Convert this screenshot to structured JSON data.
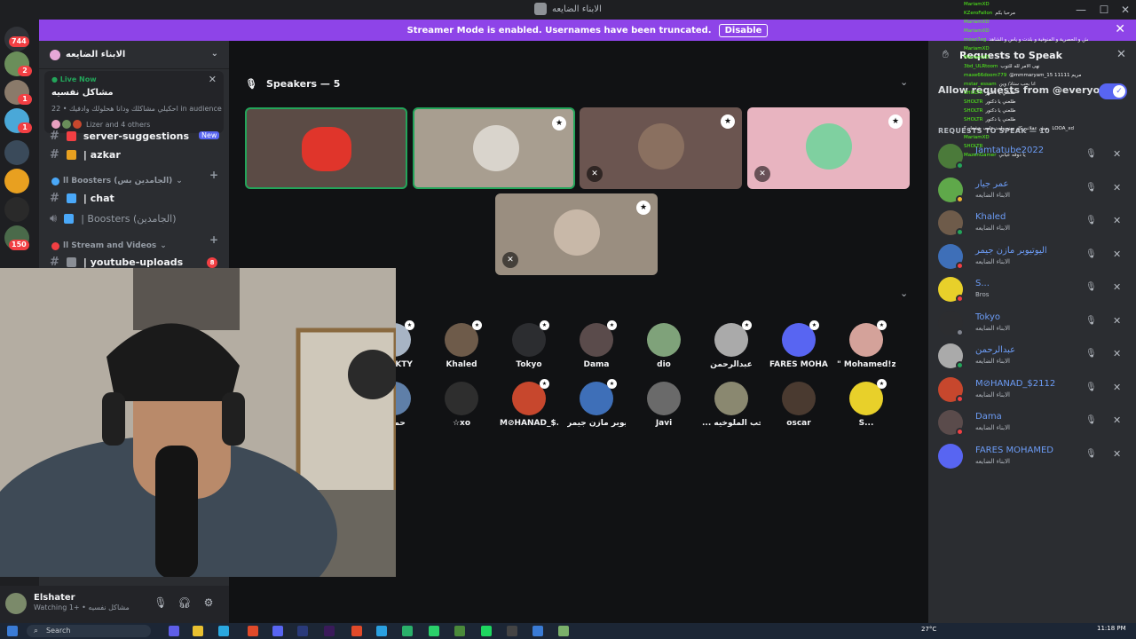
{
  "window": {
    "title": "الابناء الضايعه"
  },
  "banner": {
    "message": "Streamer Mode is enabled. Usernames have been truncated.",
    "disable_label": "Disable"
  },
  "rail": {
    "badges": [
      "744",
      "2",
      "1",
      "1",
      "150"
    ]
  },
  "sidebar": {
    "server_name": "الابناء الضايعه",
    "live": {
      "label": "Live Now",
      "title": "مشاكل نفسيه",
      "description": "احكيلي مشاكلك ودانا هحلولك وادفيك • 22 in audience",
      "others": "Lizer and 4 others"
    },
    "channels": {
      "server_suggestions": "server-suggestions",
      "server_suggestions_badge": "New",
      "azkar": "| azkar",
      "boosters_category": "ll Boosters (الجامدين بس)",
      "chat": "| chat",
      "boosters_voice": "| Boosters (الجامدين)",
      "stream_category": "ll Stream and Videos",
      "youtube": "| youtube-uploads",
      "youtube_badge": "8"
    }
  },
  "user": {
    "name": "Elshater",
    "status": "Watching مشاكل نفسيه • +1"
  },
  "stage": {
    "speakers_header": "Speakers — 5"
  },
  "audience": [
    {
      "name": "AOOKTY",
      "color": "#a7b4c4"
    },
    {
      "name": "Khaled",
      "color": "#6e5b4a"
    },
    {
      "name": "Tokyo",
      "color": "#2c2d30"
    },
    {
      "name": "Dama",
      "color": "#5a4b4b"
    },
    {
      "name": "dio",
      "color": "#7fa27a"
    },
    {
      "name": "عبدالرحمن",
      "color": "#aaaaaa"
    },
    {
      "name": "FARES MOHA...",
      "color": "#5865f2"
    },
    {
      "name": "\" Mohamed!zx \"",
      "color": "#d4a29a"
    },
    {
      "name": "حماده",
      "color": "#5f7fa8"
    },
    {
      "name": "☆xo",
      "color": "#2e2e2e"
    },
    {
      "name": "M⊘HANAD_$...",
      "color": "#c7472d"
    },
    {
      "name": "اليوتيوبر مازن جيمر",
      "color": "#3e6fb8"
    },
    {
      "name": "Javi",
      "color": "#6a6a6a"
    },
    {
      "name": "... مش بيحب الملوخيه",
      "color": "#8a8870"
    },
    {
      "name": "oscar",
      "color": "#4a3a30"
    },
    {
      "name": "S...",
      "color": "#e8d02a"
    }
  ],
  "requests_panel": {
    "title": "Requests to Speak",
    "allow_label": "Allow requests from @everyone",
    "section_header": "REQUESTS TO SPEAK — 10",
    "items": [
      {
        "name": "Jamtatube2022",
        "sub": "",
        "avatar": "#4b7a3a",
        "status": "#23a55a"
      },
      {
        "name": "عمر جيار",
        "sub": "الابناء الضايعه",
        "avatar": "#5fa84a",
        "status": "#f0b232"
      },
      {
        "name": "Khaled",
        "sub": "الابناء الضايعه",
        "avatar": "#6e5b4a",
        "status": "#23a55a"
      },
      {
        "name": "اليوتيوبر مازن جيمر",
        "sub": "الابناء الضايعه",
        "avatar": "#3e6fb8",
        "status": "#f23f43"
      },
      {
        "name": "S...",
        "sub": "Bros",
        "avatar": "#e8d02a",
        "status": "#f23f43"
      },
      {
        "name": "Tokyo",
        "sub": "الابناء الضايعه",
        "avatar": "#2c2d30",
        "status": "#80848e"
      },
      {
        "name": "عبدالرحمن",
        "sub": "الابناء الضايعه",
        "avatar": "#aaaaaa",
        "status": "#23a55a"
      },
      {
        "name": "M⊘HANAD_$2112",
        "sub": "الابناء الضايعه",
        "avatar": "#c7472d",
        "status": "#f23f43"
      },
      {
        "name": "Dama",
        "sub": "الابناء الضايعه",
        "avatar": "#5a4b4b",
        "status": "#f23f43"
      },
      {
        "name": "FARES MOHAMED",
        "sub": "الابناء الضايعه",
        "avatar": "#5865f2",
        "status": ""
      }
    ]
  },
  "chat_overlay": [
    {
      "user": "MariamXD",
      "text": ""
    },
    {
      "user": "KZeroFallon",
      "text": "مرحبا بكم"
    },
    {
      "user": "MariamXD",
      "text": ""
    },
    {
      "user": "MariamXD",
      "text": ""
    },
    {
      "user": "moaz7eg",
      "text": "نداني العيش و الحصرية و المنوفية و بلدت و ياس و الشاهد"
    },
    {
      "user": "MariamXD",
      "text": ""
    },
    {
      "user": "MariamXD",
      "text": ""
    },
    {
      "user": "3bd_ULRtoom",
      "text": "نهى الامر لله للتوب"
    },
    {
      "user": "maxe66doom779",
      "text": "@mmmaryam_15 مريم 11111"
    },
    {
      "user": "mstar_essam",
      "text": "انا بحب ستاذ/ وين"
    },
    {
      "user": "SHOLTR",
      "text": "طلعني يا دكتور"
    },
    {
      "user": "SHOLTR",
      "text": "طلعني يا دكتور"
    },
    {
      "user": "SHOLTR",
      "text": "طلعني يا دكتور"
    },
    {
      "user": "SHOLTR",
      "text": "طلعني يا دكتور"
    },
    {
      "user": "",
      "text": "مش عقلاني كل سنه ولحد عليب بتشغار ؟ LOOA_xd"
    },
    {
      "user": "MariamXD",
      "text": ""
    },
    {
      "user": "SHOLTR",
      "text": ""
    },
    {
      "user": "MazenGamer",
      "text": "يا دوقه عياني"
    }
  ],
  "taskbar": {
    "search_label": "Search",
    "weather": "27°C",
    "time": "11:18 PM"
  }
}
